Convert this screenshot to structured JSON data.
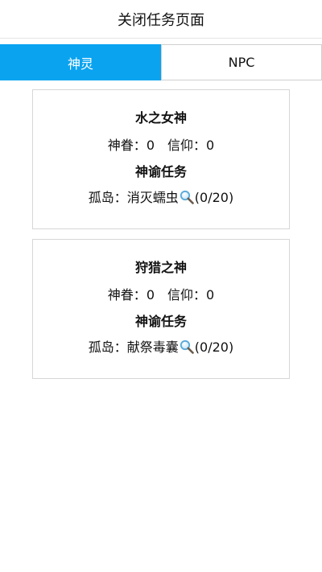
{
  "header": {
    "title": "关闭任务页面"
  },
  "tabs": [
    {
      "label": "神灵",
      "active": true
    },
    {
      "label": "NPC",
      "active": false
    }
  ],
  "cards": [
    {
      "name": "水之女神",
      "favor_label": "神眷：",
      "favor_value": "0",
      "faith_label": "信仰：",
      "faith_value": "0",
      "section_title": "神谕任务",
      "quest_location": "孤岛：",
      "quest_name": "消灭蠕虫",
      "quest_progress": "(0/20)",
      "quest_icon": "search-icon"
    },
    {
      "name": "狩猎之神",
      "favor_label": "神眷：",
      "favor_value": "0",
      "faith_label": "信仰：",
      "faith_value": "0",
      "section_title": "神谕任务",
      "quest_location": "孤岛：",
      "quest_name": "献祭毒囊",
      "quest_progress": "(0/20)",
      "quest_icon": "search-icon"
    }
  ],
  "colors": {
    "active_tab": "#0aa3f0",
    "border": "#d6d6d6"
  }
}
